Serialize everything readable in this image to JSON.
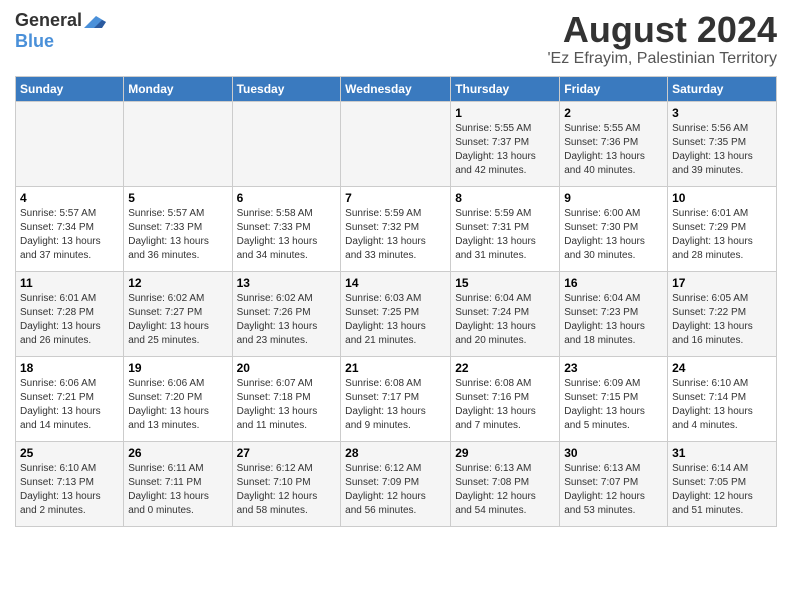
{
  "header": {
    "logo_general": "General",
    "logo_blue": "Blue",
    "month_year": "August 2024",
    "location": "'Ez Efrayim, Palestinian Territory"
  },
  "days_of_week": [
    "Sunday",
    "Monday",
    "Tuesday",
    "Wednesday",
    "Thursday",
    "Friday",
    "Saturday"
  ],
  "weeks": [
    [
      {
        "day": "",
        "info": ""
      },
      {
        "day": "",
        "info": ""
      },
      {
        "day": "",
        "info": ""
      },
      {
        "day": "",
        "info": ""
      },
      {
        "day": "1",
        "info": "Sunrise: 5:55 AM\nSunset: 7:37 PM\nDaylight: 13 hours\nand 42 minutes."
      },
      {
        "day": "2",
        "info": "Sunrise: 5:55 AM\nSunset: 7:36 PM\nDaylight: 13 hours\nand 40 minutes."
      },
      {
        "day": "3",
        "info": "Sunrise: 5:56 AM\nSunset: 7:35 PM\nDaylight: 13 hours\nand 39 minutes."
      }
    ],
    [
      {
        "day": "4",
        "info": "Sunrise: 5:57 AM\nSunset: 7:34 PM\nDaylight: 13 hours\nand 37 minutes."
      },
      {
        "day": "5",
        "info": "Sunrise: 5:57 AM\nSunset: 7:33 PM\nDaylight: 13 hours\nand 36 minutes."
      },
      {
        "day": "6",
        "info": "Sunrise: 5:58 AM\nSunset: 7:33 PM\nDaylight: 13 hours\nand 34 minutes."
      },
      {
        "day": "7",
        "info": "Sunrise: 5:59 AM\nSunset: 7:32 PM\nDaylight: 13 hours\nand 33 minutes."
      },
      {
        "day": "8",
        "info": "Sunrise: 5:59 AM\nSunset: 7:31 PM\nDaylight: 13 hours\nand 31 minutes."
      },
      {
        "day": "9",
        "info": "Sunrise: 6:00 AM\nSunset: 7:30 PM\nDaylight: 13 hours\nand 30 minutes."
      },
      {
        "day": "10",
        "info": "Sunrise: 6:01 AM\nSunset: 7:29 PM\nDaylight: 13 hours\nand 28 minutes."
      }
    ],
    [
      {
        "day": "11",
        "info": "Sunrise: 6:01 AM\nSunset: 7:28 PM\nDaylight: 13 hours\nand 26 minutes."
      },
      {
        "day": "12",
        "info": "Sunrise: 6:02 AM\nSunset: 7:27 PM\nDaylight: 13 hours\nand 25 minutes."
      },
      {
        "day": "13",
        "info": "Sunrise: 6:02 AM\nSunset: 7:26 PM\nDaylight: 13 hours\nand 23 minutes."
      },
      {
        "day": "14",
        "info": "Sunrise: 6:03 AM\nSunset: 7:25 PM\nDaylight: 13 hours\nand 21 minutes."
      },
      {
        "day": "15",
        "info": "Sunrise: 6:04 AM\nSunset: 7:24 PM\nDaylight: 13 hours\nand 20 minutes."
      },
      {
        "day": "16",
        "info": "Sunrise: 6:04 AM\nSunset: 7:23 PM\nDaylight: 13 hours\nand 18 minutes."
      },
      {
        "day": "17",
        "info": "Sunrise: 6:05 AM\nSunset: 7:22 PM\nDaylight: 13 hours\nand 16 minutes."
      }
    ],
    [
      {
        "day": "18",
        "info": "Sunrise: 6:06 AM\nSunset: 7:21 PM\nDaylight: 13 hours\nand 14 minutes."
      },
      {
        "day": "19",
        "info": "Sunrise: 6:06 AM\nSunset: 7:20 PM\nDaylight: 13 hours\nand 13 minutes."
      },
      {
        "day": "20",
        "info": "Sunrise: 6:07 AM\nSunset: 7:18 PM\nDaylight: 13 hours\nand 11 minutes."
      },
      {
        "day": "21",
        "info": "Sunrise: 6:08 AM\nSunset: 7:17 PM\nDaylight: 13 hours\nand 9 minutes."
      },
      {
        "day": "22",
        "info": "Sunrise: 6:08 AM\nSunset: 7:16 PM\nDaylight: 13 hours\nand 7 minutes."
      },
      {
        "day": "23",
        "info": "Sunrise: 6:09 AM\nSunset: 7:15 PM\nDaylight: 13 hours\nand 5 minutes."
      },
      {
        "day": "24",
        "info": "Sunrise: 6:10 AM\nSunset: 7:14 PM\nDaylight: 13 hours\nand 4 minutes."
      }
    ],
    [
      {
        "day": "25",
        "info": "Sunrise: 6:10 AM\nSunset: 7:13 PM\nDaylight: 13 hours\nand 2 minutes."
      },
      {
        "day": "26",
        "info": "Sunrise: 6:11 AM\nSunset: 7:11 PM\nDaylight: 13 hours\nand 0 minutes."
      },
      {
        "day": "27",
        "info": "Sunrise: 6:12 AM\nSunset: 7:10 PM\nDaylight: 12 hours\nand 58 minutes."
      },
      {
        "day": "28",
        "info": "Sunrise: 6:12 AM\nSunset: 7:09 PM\nDaylight: 12 hours\nand 56 minutes."
      },
      {
        "day": "29",
        "info": "Sunrise: 6:13 AM\nSunset: 7:08 PM\nDaylight: 12 hours\nand 54 minutes."
      },
      {
        "day": "30",
        "info": "Sunrise: 6:13 AM\nSunset: 7:07 PM\nDaylight: 12 hours\nand 53 minutes."
      },
      {
        "day": "31",
        "info": "Sunrise: 6:14 AM\nSunset: 7:05 PM\nDaylight: 12 hours\nand 51 minutes."
      }
    ]
  ]
}
